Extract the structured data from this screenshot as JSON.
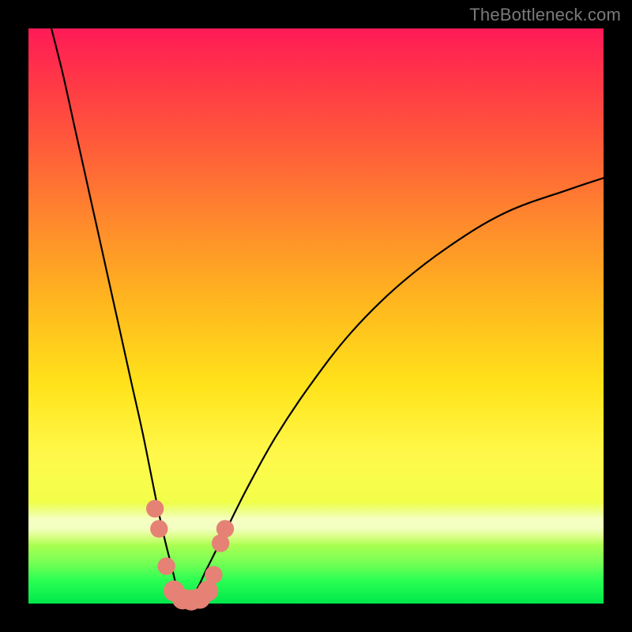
{
  "watermark_text": "TheBottleneck.com",
  "colors": {
    "background_frame": "#000000",
    "gradient_top": "#ff1a57",
    "gradient_mid": "#ffe31a",
    "gradient_bottom": "#00e84b",
    "curve": "#000000",
    "marker": "#e58275"
  },
  "chart_data": {
    "type": "line",
    "title": "",
    "xlabel": "",
    "ylabel": "",
    "xlim": [
      0,
      100
    ],
    "ylim": [
      0,
      100
    ],
    "grid": false,
    "legend": false,
    "description": "V-shaped bottleneck curve on rainbow gradient. Both arms start high (red zone, ~100%) and descend toward a shared minimum near x≈27 at y≈0 (green zone). Left arm is steep; right arm rises more gradually. Salmon-colored markers cluster near the trough on both arms and along the bottom between them.",
    "series": [
      {
        "name": "left-arm",
        "x": [
          4,
          6,
          8,
          10,
          12,
          14,
          16,
          18,
          20,
          22,
          23.5,
          25,
          26,
          27
        ],
        "y": [
          100,
          92,
          83,
          74,
          65,
          56,
          47,
          38,
          29,
          19,
          12,
          6,
          2,
          0
        ]
      },
      {
        "name": "right-arm",
        "x": [
          27,
          29,
          31,
          34,
          38,
          43,
          49,
          56,
          64,
          73,
          83,
          94,
          100
        ],
        "y": [
          0,
          2,
          6,
          12,
          20,
          29,
          38,
          47,
          55,
          62,
          68,
          72,
          74
        ]
      }
    ],
    "markers": [
      {
        "x": 22.0,
        "y": 16.5,
        "r": 1.1
      },
      {
        "x": 22.7,
        "y": 13.0,
        "r": 1.1
      },
      {
        "x": 24.0,
        "y": 6.5,
        "r": 1.1
      },
      {
        "x": 25.3,
        "y": 2.2,
        "r": 1.4
      },
      {
        "x": 26.8,
        "y": 0.8,
        "r": 1.4
      },
      {
        "x": 28.3,
        "y": 0.6,
        "r": 1.4
      },
      {
        "x": 29.8,
        "y": 0.9,
        "r": 1.4
      },
      {
        "x": 31.2,
        "y": 2.2,
        "r": 1.4
      },
      {
        "x": 32.2,
        "y": 5.0,
        "r": 1.1
      },
      {
        "x": 33.4,
        "y": 10.5,
        "r": 1.1
      },
      {
        "x": 34.2,
        "y": 13.0,
        "r": 1.1
      }
    ]
  }
}
